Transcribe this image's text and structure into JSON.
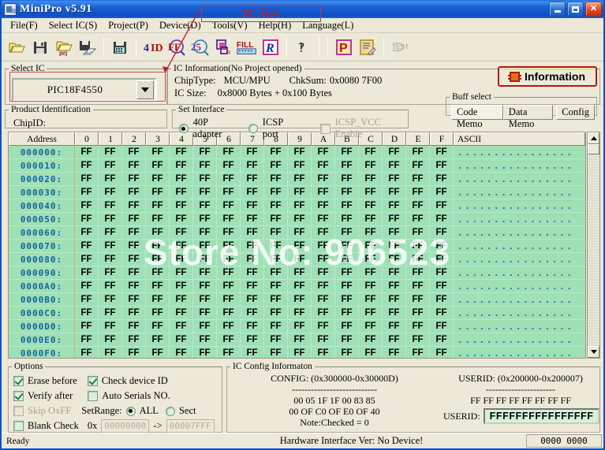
{
  "window": {
    "title": "MiniPro v5.91",
    "icon": "app-icon",
    "buttons": {
      "minimize": "–",
      "maximize": "□",
      "close": "✕"
    }
  },
  "menu": [
    {
      "label": "File(F)",
      "text": "File",
      "key": "F"
    },
    {
      "label": "Select IC(S)",
      "text": "Select IC",
      "key": "S"
    },
    {
      "label": "Project(P)",
      "text": "Project",
      "key": "P"
    },
    {
      "label": "Device(D)",
      "text": "Device",
      "key": "D"
    },
    {
      "label": "Tools(V)",
      "text": "Tools",
      "key": "V"
    },
    {
      "label": "Help(H)",
      "text": "Help",
      "key": "H"
    },
    {
      "label": "Language(L)",
      "text": "Language",
      "key": "L"
    }
  ],
  "toolbar": {
    "items": [
      {
        "name": "open-file-icon",
        "glyph": "folder-open"
      },
      {
        "name": "save-file-icon",
        "glyph": "floppy"
      },
      {
        "name": "open-project-icon",
        "glyph": "folder-prj",
        "sub": "prj"
      },
      {
        "name": "save-project-icon",
        "glyph": "floppy-save"
      },
      {
        "name": "save-as-icon",
        "glyph": "floppy-plain"
      },
      {
        "name": "device-id-icon",
        "glyph": "ID"
      },
      {
        "name": "read-icon",
        "glyph": "FF"
      },
      {
        "name": "verify-icon",
        "glyph": "25"
      },
      {
        "name": "copy-icon",
        "glyph": "copy"
      },
      {
        "name": "fill-icon",
        "glyph": "FILL"
      },
      {
        "name": "run-icon",
        "glyph": "R"
      },
      {
        "name": "help-icon",
        "glyph": "?"
      },
      {
        "name": "program-icon",
        "glyph": "P"
      },
      {
        "name": "edit-icon",
        "glyph": "pencil-page"
      },
      {
        "name": "test-icon",
        "glyph": "TEST"
      }
    ]
  },
  "annotation": {
    "label": "IC list"
  },
  "watermark": {
    "text": "Store No: 906523"
  },
  "select_ic": {
    "legend": "Select IC",
    "value": "PIC18F4550",
    "dropdown_icon": "chevron-down-icon"
  },
  "product_identification": {
    "legend": "Product Identification",
    "chip_id_label": "ChipID:",
    "chip_id_value": ""
  },
  "ic_information": {
    "legend": "IC Information(No Project opened)",
    "chip_type_label": "ChipType:",
    "chip_type_value": "MCU/MPU",
    "chksum_label": "ChkSum:",
    "chksum_value": "0x0080 7F00",
    "ic_size_label": "IC Size:",
    "ic_size_value": "0x8000 Bytes + 0x100 Bytes"
  },
  "set_interface": {
    "legend": "Set Interface",
    "adapter_label": "40P adapter",
    "adapter_selected": true,
    "icsp_label": "ICSP port",
    "icsp_selected": false,
    "icsp_vcc_label": "ICSP_VCC Enable",
    "icsp_vcc_checked": false,
    "icsp_vcc_disabled": true
  },
  "information_button": {
    "label": "Information",
    "icon": "chip-icon"
  },
  "buff_select": {
    "legend": "Buff select",
    "tabs": [
      {
        "label": "Code Memo",
        "active": true
      },
      {
        "label": "Data Memo",
        "active": false
      },
      {
        "label": "Config",
        "active": false
      }
    ]
  },
  "hex_view": {
    "headers": [
      "Address",
      "0",
      "1",
      "2",
      "3",
      "4",
      "5",
      "6",
      "7",
      "8",
      "9",
      "A",
      "B",
      "C",
      "D",
      "E",
      "F",
      "ASCII"
    ],
    "ascii_text": "................",
    "rows": [
      {
        "address": "000000:",
        "bytes": [
          "FF",
          "FF",
          "FF",
          "FF",
          "FF",
          "FF",
          "FF",
          "FF",
          "FF",
          "FF",
          "FF",
          "FF",
          "FF",
          "FF",
          "FF",
          "FF"
        ]
      },
      {
        "address": "000010:",
        "bytes": [
          "FF",
          "FF",
          "FF",
          "FF",
          "FF",
          "FF",
          "FF",
          "FF",
          "FF",
          "FF",
          "FF",
          "FF",
          "FF",
          "FF",
          "FF",
          "FF"
        ]
      },
      {
        "address": "000020:",
        "bytes": [
          "FF",
          "FF",
          "FF",
          "FF",
          "FF",
          "FF",
          "FF",
          "FF",
          "FF",
          "FF",
          "FF",
          "FF",
          "FF",
          "FF",
          "FF",
          "FF"
        ]
      },
      {
        "address": "000030:",
        "bytes": [
          "FF",
          "FF",
          "FF",
          "FF",
          "FF",
          "FF",
          "FF",
          "FF",
          "FF",
          "FF",
          "FF",
          "FF",
          "FF",
          "FF",
          "FF",
          "FF"
        ]
      },
      {
        "address": "000040:",
        "bytes": [
          "FF",
          "FF",
          "FF",
          "FF",
          "FF",
          "FF",
          "FF",
          "FF",
          "FF",
          "FF",
          "FF",
          "FF",
          "FF",
          "FF",
          "FF",
          "FF"
        ]
      },
      {
        "address": "000050:",
        "bytes": [
          "FF",
          "FF",
          "FF",
          "FF",
          "FF",
          "FF",
          "FF",
          "FF",
          "FF",
          "FF",
          "FF",
          "FF",
          "FF",
          "FF",
          "FF",
          "FF"
        ]
      },
      {
        "address": "000060:",
        "bytes": [
          "FF",
          "FF",
          "FF",
          "FF",
          "FF",
          "FF",
          "FF",
          "FF",
          "FF",
          "FF",
          "FF",
          "FF",
          "FF",
          "FF",
          "FF",
          "FF"
        ]
      },
      {
        "address": "000070:",
        "bytes": [
          "FF",
          "FF",
          "FF",
          "FF",
          "FF",
          "FF",
          "FF",
          "FF",
          "FF",
          "FF",
          "FF",
          "FF",
          "FF",
          "FF",
          "FF",
          "FF"
        ]
      },
      {
        "address": "000080:",
        "bytes": [
          "FF",
          "FF",
          "FF",
          "FF",
          "FF",
          "FF",
          "FF",
          "FF",
          "FF",
          "FF",
          "FF",
          "FF",
          "FF",
          "FF",
          "FF",
          "FF"
        ]
      },
      {
        "address": "000090:",
        "bytes": [
          "FF",
          "FF",
          "FF",
          "FF",
          "FF",
          "FF",
          "FF",
          "FF",
          "FF",
          "FF",
          "FF",
          "FF",
          "FF",
          "FF",
          "FF",
          "FF"
        ]
      },
      {
        "address": "0000A0:",
        "bytes": [
          "FF",
          "FF",
          "FF",
          "FF",
          "FF",
          "FF",
          "FF",
          "FF",
          "FF",
          "FF",
          "FF",
          "FF",
          "FF",
          "FF",
          "FF",
          "FF"
        ]
      },
      {
        "address": "0000B0:",
        "bytes": [
          "FF",
          "FF",
          "FF",
          "FF",
          "FF",
          "FF",
          "FF",
          "FF",
          "FF",
          "FF",
          "FF",
          "FF",
          "FF",
          "FF",
          "FF",
          "FF"
        ]
      },
      {
        "address": "0000C0:",
        "bytes": [
          "FF",
          "FF",
          "FF",
          "FF",
          "FF",
          "FF",
          "FF",
          "FF",
          "FF",
          "FF",
          "FF",
          "FF",
          "FF",
          "FF",
          "FF",
          "FF"
        ]
      },
      {
        "address": "0000D0:",
        "bytes": [
          "FF",
          "FF",
          "FF",
          "FF",
          "FF",
          "FF",
          "FF",
          "FF",
          "FF",
          "FF",
          "FF",
          "FF",
          "FF",
          "FF",
          "FF",
          "FF"
        ]
      },
      {
        "address": "0000E0:",
        "bytes": [
          "FF",
          "FF",
          "FF",
          "FF",
          "FF",
          "FF",
          "FF",
          "FF",
          "FF",
          "FF",
          "FF",
          "FF",
          "FF",
          "FF",
          "FF",
          "FF"
        ]
      },
      {
        "address": "0000F0:",
        "bytes": [
          "FF",
          "FF",
          "FF",
          "FF",
          "FF",
          "FF",
          "FF",
          "FF",
          "FF",
          "FF",
          "FF",
          "FF",
          "FF",
          "FF",
          "FF",
          "FF"
        ]
      }
    ]
  },
  "options": {
    "legend": "Options",
    "erase_before": {
      "label": "Erase before",
      "checked": true
    },
    "check_device_id": {
      "label": "Check device ID",
      "checked": true
    },
    "verify_after": {
      "label": "Verify after",
      "checked": true
    },
    "auto_serials": {
      "label": "Auto Serials NO.",
      "checked": false
    },
    "skip_oxff": {
      "label": "Skip OxFF",
      "checked": false,
      "disabled": true
    },
    "blank_check": {
      "label": "Blank Check",
      "checked": false
    },
    "set_range_label": "SetRange:",
    "range_all": {
      "label": "ALL",
      "selected": true
    },
    "range_sect": {
      "label": "Sect",
      "selected": false
    },
    "ox_label": "0x",
    "range_from": "00000000",
    "range_arrow": "->",
    "range_to": "00007FFF"
  },
  "ic_config": {
    "legend": "IC Config Informaton",
    "config_title": "CONFIG: (0x300000-0x30000D)",
    "divider": "---------------------------",
    "config_line1": "00 05 1F 1F 00 83 85",
    "config_line2": "00 OF C0 OF E0 OF 40",
    "note": "Note:Checked = 0",
    "userid_title": "USERID: (0x200000-0x200007)",
    "userid_divider": "----------------------",
    "userid_bytes": "FF FF FF FF FF FF FF FF",
    "userid_label": "USERID:",
    "userid_value": "FFFFFFFFFFFFFFFF"
  },
  "status_bar": {
    "left": "Ready",
    "middle": "Hardware Interface Ver: No Device!",
    "right": "0000 0000"
  },
  "colors": {
    "title_bar": "#1c5fd0",
    "hex_bg": "#9fe0b5",
    "address_text": "#1464a0",
    "ascii_text": "#2a6fb0",
    "annotation": "#c0202a",
    "face": "#ece9d8"
  }
}
